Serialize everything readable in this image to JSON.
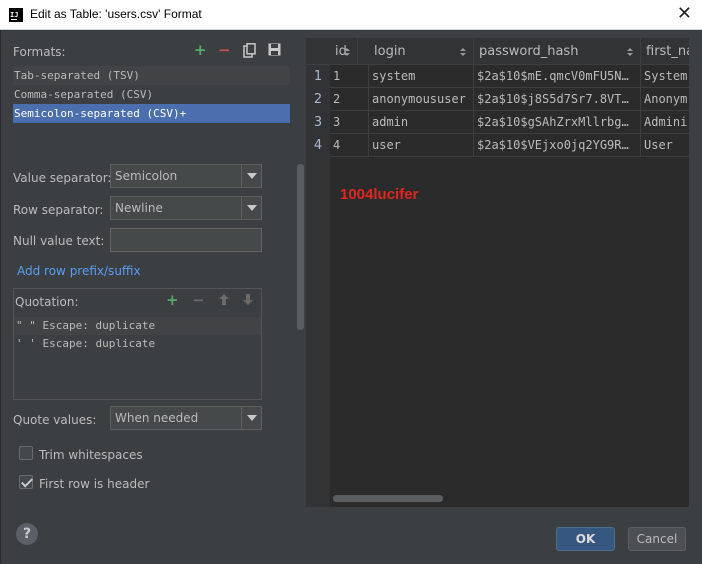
{
  "window": {
    "title": "Edit as Table: 'users.csv' Format",
    "close_glyph": "✕"
  },
  "formats": {
    "label": "Formats:",
    "items": [
      "Tab-separated (TSV)",
      "Comma-separated (CSV)",
      "Semicolon-separated (CSV)+"
    ],
    "selected_index": 2,
    "toolbar_icons": [
      "add-icon",
      "remove-icon",
      "copy-icon",
      "save-icon"
    ]
  },
  "value_separator": {
    "label": "Value separator:",
    "value": "Semicolon"
  },
  "row_separator": {
    "label": "Row separator:",
    "value": "Newline"
  },
  "null_value": {
    "label": "Null value text:",
    "value": ""
  },
  "row_prefix_link": "Add row prefix/suffix",
  "quotation": {
    "label": "Quotation:",
    "rows": [
      "\"  \"  Escape: duplicate",
      "'  '  Escape: duplicate"
    ]
  },
  "quote_values": {
    "label": "Quote values:",
    "value": "When needed"
  },
  "trim_whitespaces": {
    "label": "Trim whitespaces",
    "checked": false
  },
  "first_row_header": {
    "label": "First row is header",
    "checked": true
  },
  "table": {
    "columns": [
      "id",
      "login",
      "password_hash",
      "first_na"
    ],
    "rows": [
      {
        "num": "1",
        "cells": [
          "1",
          "system",
          "$2a$10$mE.qmcV0mFU5N…",
          "System"
        ]
      },
      {
        "num": "2",
        "cells": [
          "2",
          "anonymoususer",
          "$2a$10$j8S5d7Sr7.8VT…",
          "Anonym"
        ]
      },
      {
        "num": "3",
        "cells": [
          "3",
          "admin",
          "$2a$10$gSAhZrxMllrbg…",
          "Admini"
        ]
      },
      {
        "num": "4",
        "cells": [
          "4",
          "user",
          "$2a$10$VEjxo0jq2YG9R…",
          "User"
        ]
      }
    ]
  },
  "watermark": "1004lucifer",
  "buttons": {
    "help": "?",
    "ok": "OK",
    "cancel": "Cancel"
  },
  "colors": {
    "selection": "#4b6eaf",
    "accent_link": "#589df6",
    "add_green": "#59a869",
    "remove_red": "#c75450",
    "watermark_red": "#e0261f"
  }
}
